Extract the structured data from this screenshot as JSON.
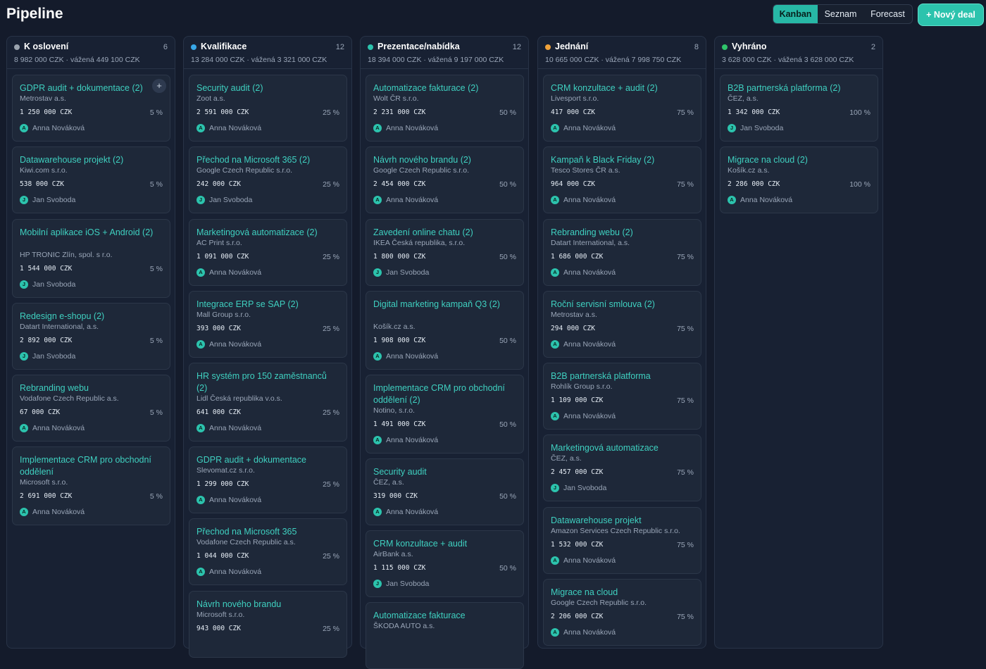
{
  "header": {
    "title": "Pipeline",
    "views": [
      "Kanban",
      "Seznam",
      "Forecast"
    ],
    "new_deal_label": "+ Nový deal"
  },
  "colors": {
    "accent": "#2cc3ad",
    "background": "#141b2b",
    "column_bg": "#182133",
    "card_bg": "#1e2839"
  },
  "columns": [
    {
      "name": "K oslovení",
      "count": "6",
      "summary": "8 982 000 CZK · vážená 449 100 CZK",
      "dot_color": "#9aa3ae",
      "cards": [
        {
          "title": "GDPR audit + dokumentace (2)",
          "company": "Metrostav a.s.",
          "amount": "1 250 000 CZK",
          "probability": "5 %",
          "owner": "Anna Nováková",
          "initial": "A"
        },
        {
          "title": "Datawarehouse projekt (2)",
          "company": "Kiwi.com s.r.o.",
          "amount": "538 000 CZK",
          "probability": "5 %",
          "owner": "Jan Svoboda",
          "initial": "J"
        },
        {
          "title": "Mobilní aplikace iOS + Android (2)",
          "company": "HP TRONIC Zlín, spol. s r.o.",
          "amount": "1 544 000 CZK",
          "probability": "5 %",
          "owner": "Jan Svoboda",
          "initial": "J"
        },
        {
          "title": "Redesign e-shopu (2)",
          "company": "Datart International, a.s.",
          "amount": "2 892 000 CZK",
          "probability": "5 %",
          "owner": "Jan Svoboda",
          "initial": "J"
        },
        {
          "title": "Rebranding webu",
          "company": "Vodafone Czech Republic a.s.",
          "amount": "67 000 CZK",
          "probability": "5 %",
          "owner": "Anna Nováková",
          "initial": "A"
        },
        {
          "title": "Implementace CRM pro obchodní oddělení",
          "company": "Microsoft s.r.o.",
          "amount": "2 691 000 CZK",
          "probability": "5 %",
          "owner": "Anna Nováková",
          "initial": "A"
        }
      ]
    },
    {
      "name": "Kvalifikace",
      "count": "12",
      "summary": "13 284 000 CZK · vážená 3 321 000 CZK",
      "dot_color": "#38a8e8",
      "cards": [
        {
          "title": "Security audit (2)",
          "company": "Zoot a.s.",
          "amount": "2 591 000 CZK",
          "probability": "25 %",
          "owner": "Anna Nováková",
          "initial": "A"
        },
        {
          "title": "Přechod na Microsoft 365 (2)",
          "company": "Google Czech Republic s.r.o.",
          "amount": "242 000 CZK",
          "probability": "25 %",
          "owner": "Jan Svoboda",
          "initial": "J"
        },
        {
          "title": "Marketingová automatizace (2)",
          "company": "AC Print s.r.o.",
          "amount": "1 091 000 CZK",
          "probability": "25 %",
          "owner": "Anna Nováková",
          "initial": "A"
        },
        {
          "title": "Integrace ERP se SAP (2)",
          "company": "Mall Group s.r.o.",
          "amount": "393 000 CZK",
          "probability": "25 %",
          "owner": "Anna Nováková",
          "initial": "A"
        },
        {
          "title": "HR systém pro 150 zaměstnanců (2)",
          "company": "Lidl Česká republika v.o.s.",
          "amount": "641 000 CZK",
          "probability": "25 %",
          "owner": "Anna Nováková",
          "initial": "A"
        },
        {
          "title": "GDPR audit + dokumentace",
          "company": "Slevomat.cz s.r.o.",
          "amount": "1 299 000 CZK",
          "probability": "25 %",
          "owner": "Anna Nováková",
          "initial": "A"
        },
        {
          "title": "Přechod na Microsoft 365",
          "company": "Vodafone Czech Republic a.s.",
          "amount": "1 044 000 CZK",
          "probability": "25 %",
          "owner": "Anna Nováková",
          "initial": "A"
        },
        {
          "title": "Návrh nového brandu",
          "company": "Microsoft s.r.o.",
          "amount": "943 000 CZK",
          "probability": "25 %",
          "owner": "",
          "initial": ""
        }
      ]
    },
    {
      "name": "Prezentace/nabídka",
      "count": "12",
      "summary": "18 394 000 CZK · vážená 9 197 000 CZK",
      "dot_color": "#2cc3ad",
      "cards": [
        {
          "title": "Automatizace fakturace (2)",
          "company": "Wolt ČR s.r.o.",
          "amount": "2 231 000 CZK",
          "probability": "50 %",
          "owner": "Anna Nováková",
          "initial": "A"
        },
        {
          "title": "Návrh nového brandu (2)",
          "company": "Google Czech Republic s.r.o.",
          "amount": "2 454 000 CZK",
          "probability": "50 %",
          "owner": "Anna Nováková",
          "initial": "A"
        },
        {
          "title": "Zavedení online chatu (2)",
          "company": "IKEA Česká republika, s.r.o.",
          "amount": "1 800 000 CZK",
          "probability": "50 %",
          "owner": "Jan Svoboda",
          "initial": "J"
        },
        {
          "title": "Digital marketing kampaň Q3 (2)",
          "company": "Košík.cz a.s.",
          "amount": "1 908 000 CZK",
          "probability": "50 %",
          "owner": "Anna Nováková",
          "initial": "A"
        },
        {
          "title": "Implementace CRM pro obchodní oddělení (2)",
          "company": "Notino, s.r.o.",
          "amount": "1 491 000 CZK",
          "probability": "50 %",
          "owner": "Anna Nováková",
          "initial": "A"
        },
        {
          "title": "Security audit",
          "company": "ČEZ, a.s.",
          "amount": "319 000 CZK",
          "probability": "50 %",
          "owner": "Anna Nováková",
          "initial": "A"
        },
        {
          "title": "CRM konzultace + audit",
          "company": "AirBank a.s.",
          "amount": "1 115 000 CZK",
          "probability": "50 %",
          "owner": "Jan Svoboda",
          "initial": "J"
        },
        {
          "title": "Automatizace fakturace",
          "company": "ŠKODA AUTO a.s.",
          "amount": "",
          "probability": "",
          "owner": "",
          "initial": ""
        }
      ]
    },
    {
      "name": "Jednání",
      "count": "8",
      "summary": "10 665 000 CZK · vážená 7 998 750 CZK",
      "dot_color": "#f0a23a",
      "cards": [
        {
          "title": "CRM konzultace + audit (2)",
          "company": "Livesport s.r.o.",
          "amount": "417 000 CZK",
          "probability": "75 %",
          "owner": "Anna Nováková",
          "initial": "A"
        },
        {
          "title": "Kampaň k Black Friday (2)",
          "company": "Tesco Stores ČR a.s.",
          "amount": "964 000 CZK",
          "probability": "75 %",
          "owner": "Anna Nováková",
          "initial": "A"
        },
        {
          "title": "Rebranding webu (2)",
          "company": "Datart International, a.s.",
          "amount": "1 686 000 CZK",
          "probability": "75 %",
          "owner": "Anna Nováková",
          "initial": "A"
        },
        {
          "title": "Roční servisní smlouva (2)",
          "company": "Metrostav a.s.",
          "amount": "294 000 CZK",
          "probability": "75 %",
          "owner": "Anna Nováková",
          "initial": "A"
        },
        {
          "title": "B2B partnerská platforma",
          "company": "Rohlík Group s.r.o.",
          "amount": "1 109 000 CZK",
          "probability": "75 %",
          "owner": "Anna Nováková",
          "initial": "A"
        },
        {
          "title": "Marketingová automatizace",
          "company": "ČEZ, a.s.",
          "amount": "2 457 000 CZK",
          "probability": "75 %",
          "owner": "Jan Svoboda",
          "initial": "J"
        },
        {
          "title": "Datawarehouse projekt",
          "company": "Amazon Services Czech Republic s.r.o.",
          "amount": "1 532 000 CZK",
          "probability": "75 %",
          "owner": "Anna Nováková",
          "initial": "A"
        },
        {
          "title": "Migrace na cloud",
          "company": "Google Czech Republic s.r.o.",
          "amount": "2 206 000 CZK",
          "probability": "75 %",
          "owner": "Anna Nováková",
          "initial": "A"
        }
      ]
    },
    {
      "name": "Vyhráno",
      "count": "2",
      "summary": "3 628 000 CZK · vážená 3 628 000 CZK",
      "dot_color": "#2fc46b",
      "cards": [
        {
          "title": "B2B partnerská platforma (2)",
          "company": "ČEZ, a.s.",
          "amount": "1 342 000 CZK",
          "probability": "100 %",
          "owner": "Jan Svoboda",
          "initial": "J"
        },
        {
          "title": "Migrace na cloud (2)",
          "company": "Košík.cz a.s.",
          "amount": "2 286 000 CZK",
          "probability": "100 %",
          "owner": "Anna Nováková",
          "initial": "A"
        }
      ]
    }
  ]
}
